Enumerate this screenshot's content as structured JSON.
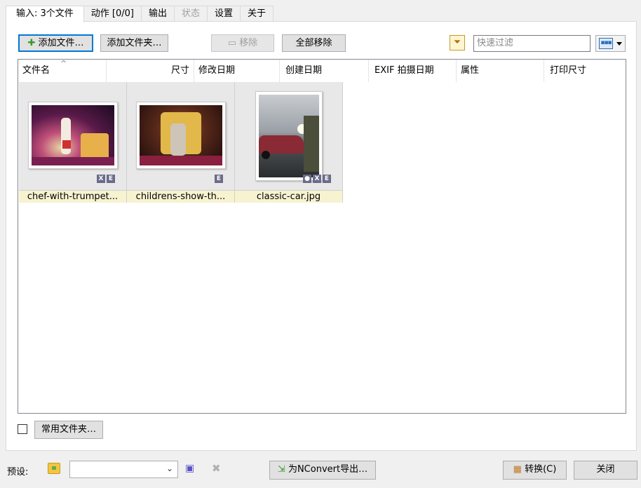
{
  "tabs": [
    {
      "label": "输入: 3个文件",
      "active": true
    },
    {
      "label": "动作 [0/0]"
    },
    {
      "label": "输出"
    },
    {
      "label": "状态",
      "disabled": true
    },
    {
      "label": "设置"
    },
    {
      "label": "关于"
    }
  ],
  "toolbar": {
    "add_files": "添加文件…",
    "add_folder": "添加文件夹…",
    "remove": "移除",
    "remove_all": "全部移除",
    "filter_placeholder": "快速过滤"
  },
  "columns": [
    "文件名",
    "尺寸",
    "修改日期",
    "创建日期",
    "EXIF 拍摄日期",
    "属性",
    "打印尺寸"
  ],
  "files": [
    {
      "name": "chef-with-trumpet...",
      "badges": [
        "X",
        "E"
      ]
    },
    {
      "name": "childrens-show-th...",
      "badges": [
        "E"
      ]
    },
    {
      "name": "classic-car.jpg",
      "badges": [
        "pin",
        "X",
        "E"
      ]
    }
  ],
  "favorites": {
    "label": "常用文件夹…",
    "checked": false
  },
  "bottom": {
    "preset_label": "预设:",
    "preset_value": "",
    "export": "为NConvert导出…",
    "convert": "转换(C)",
    "close": "关闭"
  },
  "colors": {
    "accent": "#0078d7",
    "filename_bg": "#f7f3d0"
  }
}
